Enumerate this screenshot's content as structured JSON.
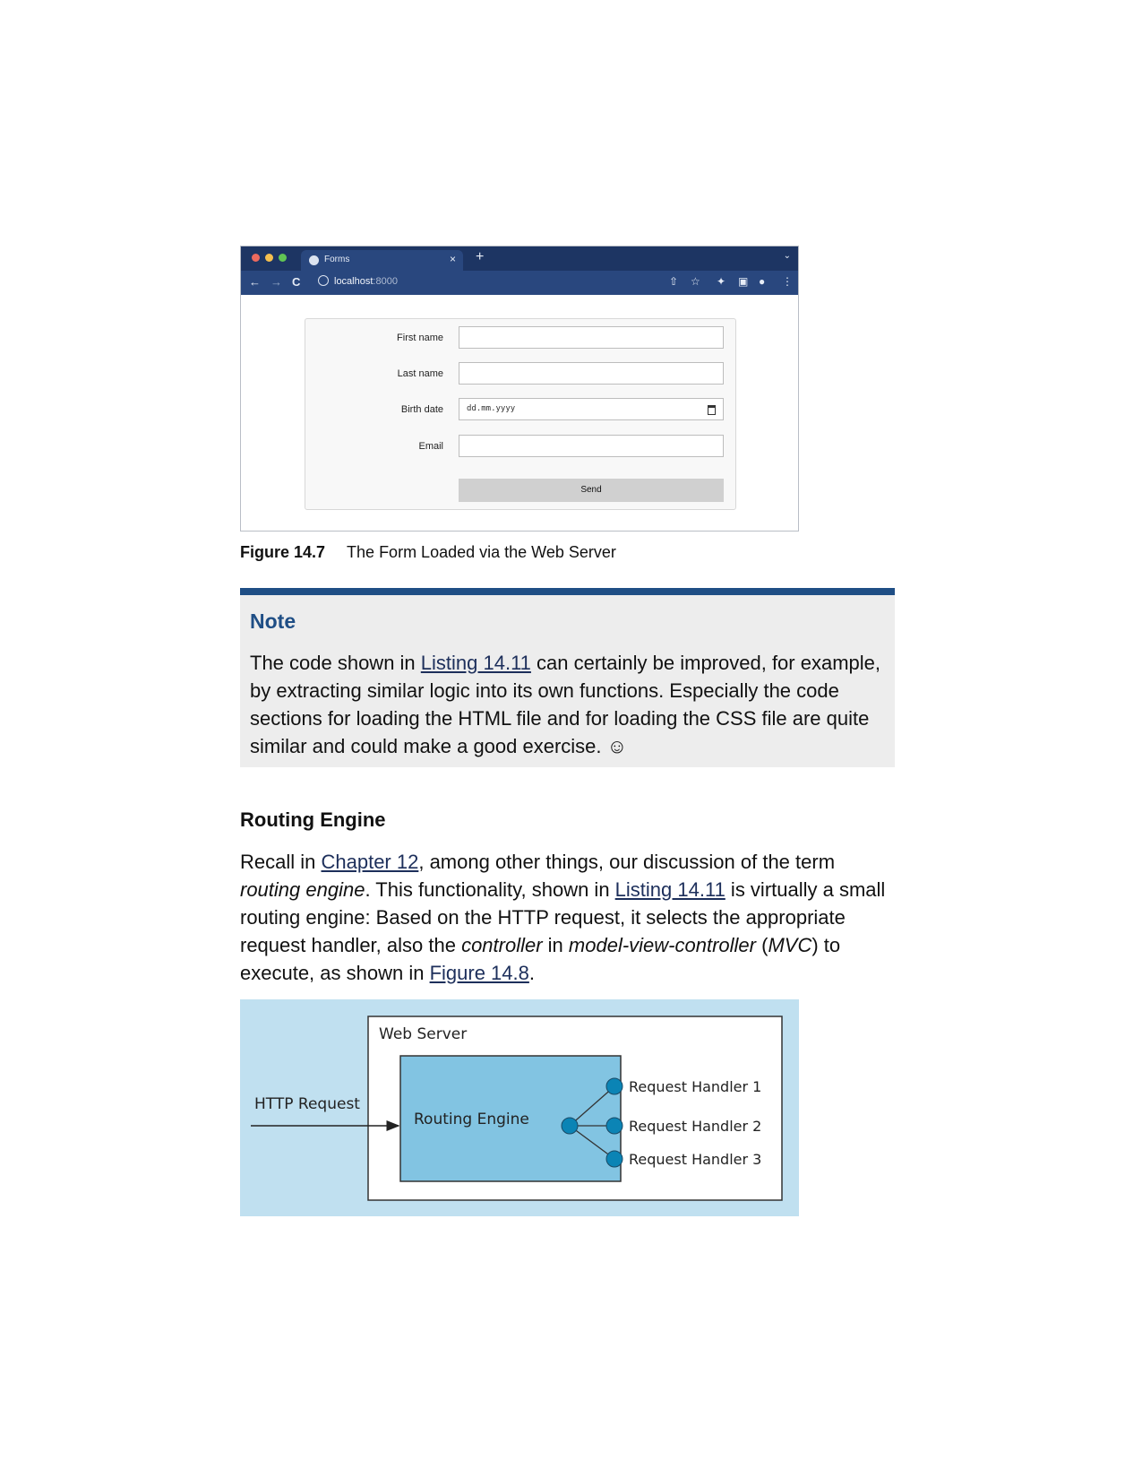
{
  "browser": {
    "tab_title": "Forms",
    "tab_close": "×",
    "new_tab": "+",
    "tab_menu": "⌄",
    "nav": {
      "back": "←",
      "forward": "→",
      "reload": "C"
    },
    "url_host": "localhost",
    "url_port": ":8000",
    "toolbar_icons": {
      "share": "⇧",
      "star": "☆",
      "extensions": "✦",
      "sidepanel": "▣",
      "profile": "●",
      "menu": "⋮"
    },
    "traffic_colors": [
      "#ec6a5e",
      "#f4bf4f",
      "#61c554"
    ]
  },
  "form": {
    "first_name_label": "First name",
    "last_name_label": "Last name",
    "birth_date_label": "Birth date",
    "birth_date_placeholder": "dd.mm.yyyy",
    "email_label": "Email",
    "send_label": "Send"
  },
  "figure_14_7": {
    "number": "Figure 14.7",
    "caption": "The Form Loaded via the Web Server"
  },
  "note": {
    "title": "Note",
    "text_1": "The code shown in ",
    "link_1": "Listing 14.11",
    "text_2": " can certainly be improved, for example, by extracting similar logic into its own functions. Especially the code sections for loading the HTML file and for loading the CSS file are quite similar and could make a good exercise. ☺"
  },
  "routing": {
    "heading": "Routing Engine",
    "p1": "Recall in ",
    "link_chapter": "Chapter 12",
    "p2": ", among other things, our discussion of the term ",
    "em_routing": "routing engine",
    "p3": ". This functionality, shown in ",
    "link_listing": "Listing 14.11",
    "p4": " is virtually a small routing engine: Based on the HTTP request, it selects the appropriate request handler, also the ",
    "em_controller": "controller",
    "p5": " in ",
    "em_mvc_full": "model-view-controller",
    "p6": " (",
    "em_mvc": "MVC",
    "p7": ") to execute, as shown in ",
    "link_figure": "Figure 14.8",
    "p8": "."
  },
  "diagram": {
    "web_server": "Web Server",
    "http_request": "HTTP Request",
    "routing_engine": "Routing Engine",
    "handlers": [
      "Request Handler 1",
      "Request Handler 2",
      "Request Handler 3"
    ],
    "colors": {
      "background": "#c0e0f0",
      "engine_fill": "#82c4e2",
      "node": "#0b84b5"
    }
  }
}
